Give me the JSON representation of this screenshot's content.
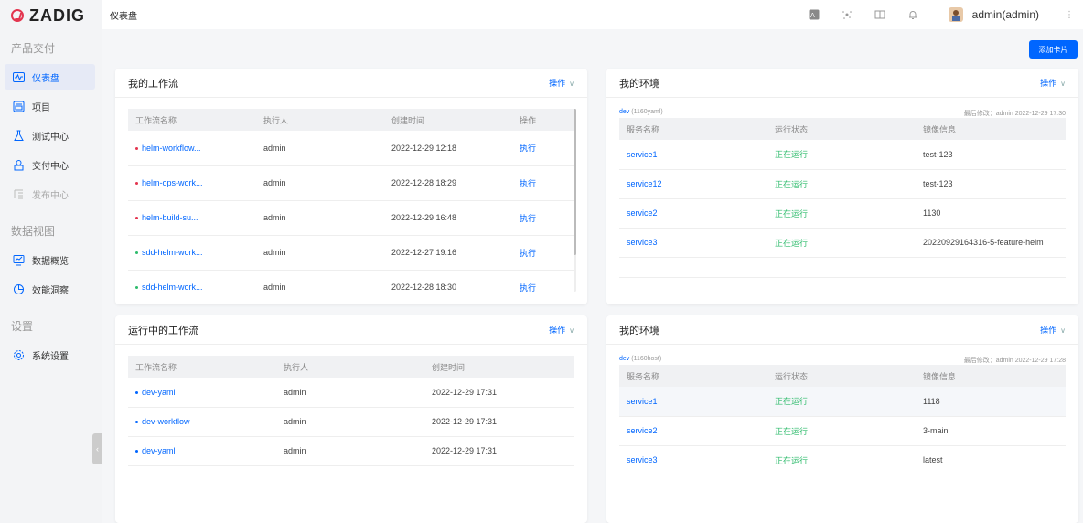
{
  "sidebar": {
    "logo": "ZADIG",
    "groups": [
      {
        "label": "产品交付"
      },
      {
        "label": "数据视图"
      },
      {
        "label": "设置"
      }
    ],
    "items": [
      {
        "label": "仪表盘"
      },
      {
        "label": "项目"
      },
      {
        "label": "测试中心"
      },
      {
        "label": "交付中心"
      },
      {
        "label": "发布中心"
      },
      {
        "label": "数据概览"
      },
      {
        "label": "效能洞察"
      },
      {
        "label": "系统设置"
      }
    ]
  },
  "header": {
    "breadcrumb": "仪表盘",
    "username": "admin(admin)"
  },
  "add_card": "添加卡片",
  "my_workflows": {
    "title": "我的工作流",
    "op": "操作",
    "columns": [
      "工作流名称",
      "执行人",
      "创建时间",
      "操作"
    ],
    "rows": [
      {
        "name": "helm-workflow...",
        "status": "red",
        "user": "admin",
        "time": "2022-12-29 12:18",
        "action": "执行"
      },
      {
        "name": "helm-ops-work...",
        "status": "red",
        "user": "admin",
        "time": "2022-12-28 18:29",
        "action": "执行"
      },
      {
        "name": "helm-build-su...",
        "status": "red",
        "user": "admin",
        "time": "2022-12-29 16:48",
        "action": "执行"
      },
      {
        "name": "sdd-helm-work...",
        "status": "green",
        "user": "admin",
        "time": "2022-12-27 19:16",
        "action": "执行"
      },
      {
        "name": "sdd-helm-work...",
        "status": "green",
        "user": "admin",
        "time": "2022-12-28 18:30",
        "action": "执行"
      }
    ]
  },
  "running_workflows": {
    "title": "运行中的工作流",
    "op": "操作",
    "columns": [
      "工作流名称",
      "执行人",
      "创建时间"
    ],
    "rows": [
      {
        "name": "dev-yaml",
        "user": "admin",
        "time": "2022-12-29 17:31"
      },
      {
        "name": "dev-workflow",
        "user": "admin",
        "time": "2022-12-29 17:31"
      },
      {
        "name": "dev-yaml",
        "user": "admin",
        "time": "2022-12-29 17:31"
      }
    ]
  },
  "env1": {
    "title": "我的环境",
    "op": "操作",
    "env_name": "dev",
    "env_project": "(1160yaml)",
    "modified": "最后修改：admin 2022-12-29 17:30",
    "columns": [
      "服务名称",
      "运行状态",
      "镜像信息"
    ],
    "rows": [
      {
        "service": "service1",
        "status": "正在运行",
        "image": "test-123"
      },
      {
        "service": "service12",
        "status": "正在运行",
        "image": "test-123"
      },
      {
        "service": "service2",
        "status": "正在运行",
        "image": "1130"
      },
      {
        "service": "service3",
        "status": "正在运行",
        "image": "20220929164316-5-feature-helm"
      }
    ]
  },
  "env2": {
    "title": "我的环境",
    "op": "操作",
    "env_name": "dev",
    "env_project": "(1160host)",
    "modified": "最后修改：admin 2022-12-29 17:28",
    "columns": [
      "服务名称",
      "运行状态",
      "镜像信息"
    ],
    "rows": [
      {
        "service": "service1",
        "status": "正在运行",
        "image": "1118"
      },
      {
        "service": "service2",
        "status": "正在运行",
        "image": "3-main"
      },
      {
        "service": "service3",
        "status": "正在运行",
        "image": "latest"
      }
    ]
  }
}
